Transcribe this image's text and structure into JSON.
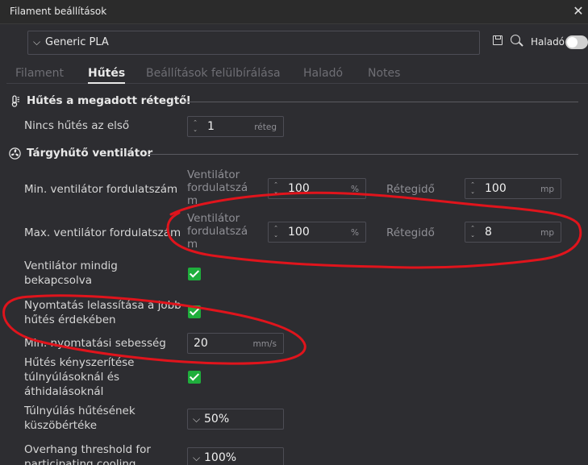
{
  "window": {
    "title": "Filament beállítások"
  },
  "preset": {
    "selected": "Generic PLA",
    "advanced_label": "Haladó"
  },
  "tabs": [
    {
      "label": "Filament"
    },
    {
      "label": "Hűtés"
    },
    {
      "label": "Beállítások felülbírálása"
    },
    {
      "label": "Haladó"
    },
    {
      "label": "Notes"
    }
  ],
  "sections": {
    "cooling_layer": {
      "title": "Hűtés a megadott rétegtől",
      "no_cooling_label": "Nincs hűtés az első",
      "no_cooling_value": "1",
      "no_cooling_unit": "réteg"
    },
    "part_fan": {
      "title": "Tárgyhűtő ventilátor",
      "min_fan": {
        "label": "Min. ventilátor fordulatszám",
        "speed_label": "Ventilátor fordulatszá m",
        "speed_value": "100",
        "speed_unit": "%",
        "time_label": "Rétegidő",
        "time_value": "100",
        "time_unit": "mp"
      },
      "max_fan": {
        "label": "Max. ventilátor fordulatszám",
        "speed_label": "Ventilátor fordulatszá m",
        "speed_value": "100",
        "speed_unit": "%",
        "time_label": "Rétegidő",
        "time_value": "8",
        "time_unit": "mp"
      },
      "fan_always_on": {
        "label": "Ventilátor mindig bekapcsolva",
        "checked": true
      },
      "slow_down": {
        "label": "Nyomtatás lelassítása a jobb hűtés érdekében",
        "checked": true
      },
      "min_print_speed": {
        "label": "Min. nyomtatási sebesség",
        "value": "20",
        "unit": "mm/s"
      },
      "force_cooling": {
        "label": "Hűtés kényszerítése túlnyúlásoknál és áthidalásoknál",
        "checked": true
      },
      "overhang_threshold": {
        "label": "Túlnyúlás hűtésének küszöbértéke",
        "value": "50%"
      },
      "overhang_participating": {
        "label": "Overhang threshold for participating cooling",
        "value": "100%"
      }
    }
  },
  "colors": {
    "background": "#2d2d31",
    "checkbox": "#1fae3c",
    "annotation": "#e0141c"
  },
  "icons": {
    "close": "close-icon",
    "chevron": "chevron-down-icon",
    "save": "save-icon",
    "search": "search-icon",
    "thermometer": "thermometer-icon",
    "fan": "fan-icon"
  }
}
